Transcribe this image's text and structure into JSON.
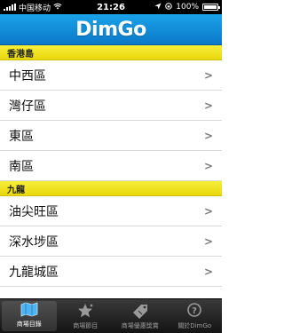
{
  "status": {
    "carrier": "中国移动",
    "time": "21:26",
    "battery": "100%"
  },
  "header": {
    "logo": "DimGo"
  },
  "list": {
    "sections": [
      {
        "title": "香港島",
        "items": [
          "中西區",
          "灣仔區",
          "東區",
          "南區"
        ]
      },
      {
        "title": "九龍",
        "items": [
          "油尖旺區",
          "深水埗區",
          "九龍城區"
        ]
      }
    ]
  },
  "tabs": [
    {
      "label": "商場目錄",
      "icon": "map-icon",
      "active": true
    },
    {
      "label": "商場節目",
      "icon": "star-icon",
      "active": false
    },
    {
      "label": "商場優惠獎賞",
      "icon": "coupon-icon",
      "active": false
    },
    {
      "label": "關於DimGo",
      "icon": "info-icon",
      "active": false
    }
  ],
  "colors": {
    "header": "#0b78c9",
    "section": "#efe025",
    "tab_bar": "#1f1f1f"
  }
}
